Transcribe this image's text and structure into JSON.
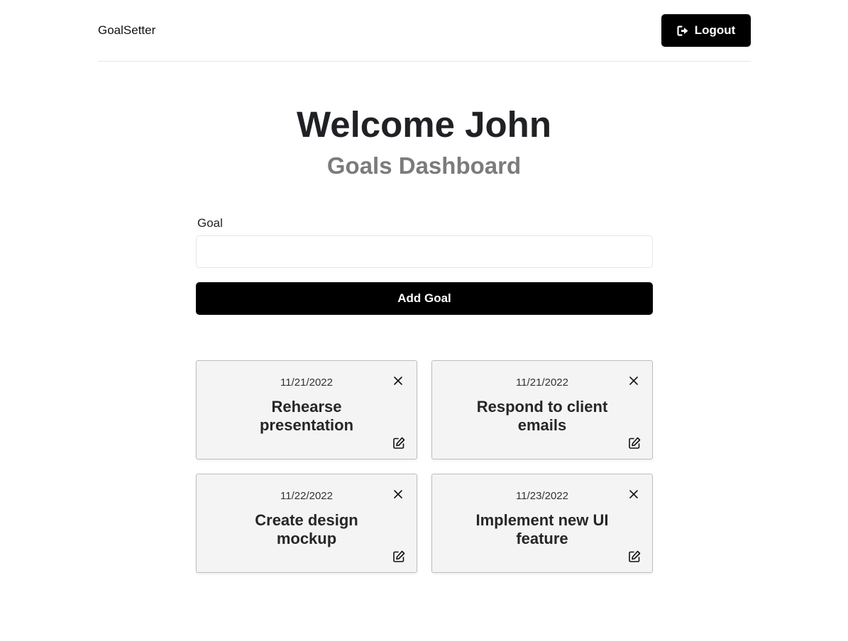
{
  "header": {
    "brand": "GoalSetter",
    "logout_label": "Logout",
    "logout_icon": "sign-out-icon"
  },
  "main": {
    "title": "Welcome John",
    "subtitle": "Goals Dashboard"
  },
  "form": {
    "goal_label": "Goal",
    "goal_value": "",
    "add_button_label": "Add Goal"
  },
  "goals": [
    {
      "date": "11/21/2022",
      "text": "Rehearse presentation"
    },
    {
      "date": "11/21/2022",
      "text": "Respond to client emails"
    },
    {
      "date": "11/22/2022",
      "text": "Create design mockup"
    },
    {
      "date": "11/23/2022",
      "text": "Implement new UI feature"
    }
  ],
  "colors": {
    "primary_button": "#000000",
    "card_background": "#f4f4f4",
    "subtitle": "#7b7b7b"
  },
  "icons": {
    "delete": "close-icon",
    "edit": "edit-icon"
  }
}
